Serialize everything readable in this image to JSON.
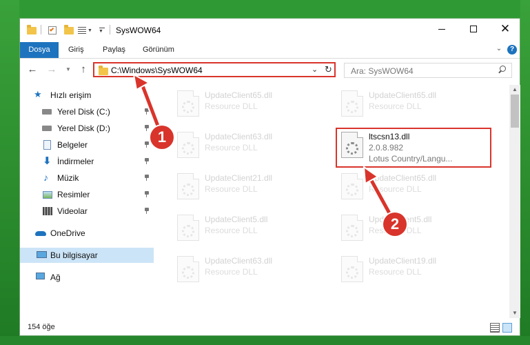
{
  "window": {
    "title": "SysWOW64"
  },
  "ribbon": {
    "tabs": [
      "Dosya",
      "Giriş",
      "Paylaş",
      "Görünüm"
    ]
  },
  "nav": {
    "address": "C:\\Windows\\SysWOW64",
    "search_placeholder": "Ara: SysWOW64"
  },
  "sidebar": {
    "items": [
      {
        "label": "Hızlı erişim",
        "icon": "star-icon"
      },
      {
        "label": "Yerel Disk (C:)",
        "icon": "drive-icon"
      },
      {
        "label": "Yerel Disk (D:)",
        "icon": "drive-icon"
      },
      {
        "label": "Belgeler",
        "icon": "documents-icon"
      },
      {
        "label": "İndirmeler",
        "icon": "download-icon"
      },
      {
        "label": "Müzik",
        "icon": "music-icon"
      },
      {
        "label": "Resimler",
        "icon": "pictures-icon"
      },
      {
        "label": "Videolar",
        "icon": "videos-icon"
      },
      {
        "label": "OneDrive",
        "icon": "cloud-icon"
      },
      {
        "label": "Bu bilgisayar",
        "icon": "computer-icon"
      },
      {
        "label": "Ağ",
        "icon": "network-icon"
      }
    ]
  },
  "files": [
    {
      "name": "UpdateClient65.dll",
      "desc": "Resource DLL"
    },
    {
      "name": "UpdateClient65.dll",
      "desc": "Resource DLL"
    },
    {
      "name": "UpdateClient63.dll",
      "desc": "Resource DLL"
    },
    {
      "name": "ltscsn13.dll",
      "version": "2.0.8.982",
      "desc": "Lotus Country/Langu..."
    },
    {
      "name": "UpdateClient21.dll",
      "desc": "Resource DLL"
    },
    {
      "name": "UpdateClient65.dll",
      "desc": "Resource DLL"
    },
    {
      "name": "UpdateClient5.dll",
      "desc": "Resource DLL"
    },
    {
      "name": "UpdateClient5.dll",
      "desc": "Resource DLL"
    },
    {
      "name": "UpdateClient63.dll",
      "desc": "Resource DLL"
    },
    {
      "name": "UpdateClient19.dll",
      "desc": "Resource DLL"
    }
  ],
  "status": {
    "count": "154 öğe"
  },
  "annotations": {
    "step1": "1",
    "step2": "2",
    "color": "#d9342b"
  }
}
